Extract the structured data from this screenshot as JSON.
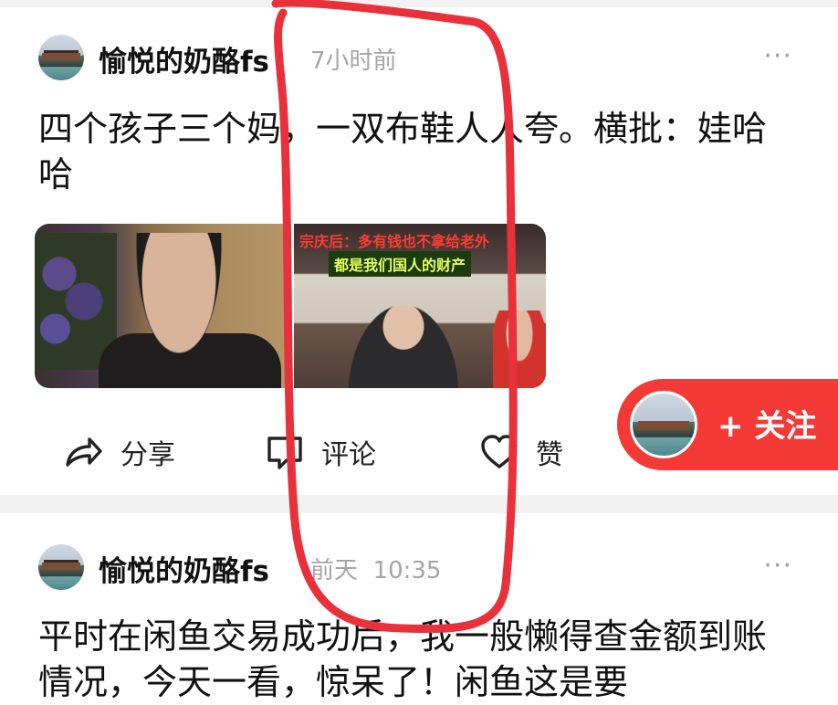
{
  "posts": [
    {
      "author": "愉悦的奶酪fs",
      "time": "7小时前",
      "more": "···",
      "text": "四个孩子三个妈，一双布鞋人人夸。横批：娃哈哈",
      "image_caption_top": "宗庆后：多有钱也不拿给老外",
      "image_caption_bottom": "都是我们国人的财产",
      "actions": {
        "share": "分享",
        "comment": "评论",
        "like": "赞"
      }
    },
    {
      "author": "愉悦的奶酪fs",
      "time": "前天  10:35",
      "more": "···",
      "text": "平时在闲鱼交易成功后，我一般懒得查金额到账情况，今天一看，惊呆了！闲鱼这是要"
    }
  ],
  "follow_button": {
    "label": "+ 关注"
  },
  "colors": {
    "accent_red": "#f33a37",
    "annotation_red": "#e8313a",
    "muted_text": "#a5a5a5"
  },
  "icons": [
    "share-icon",
    "comment-icon",
    "like-icon",
    "more-icon"
  ]
}
